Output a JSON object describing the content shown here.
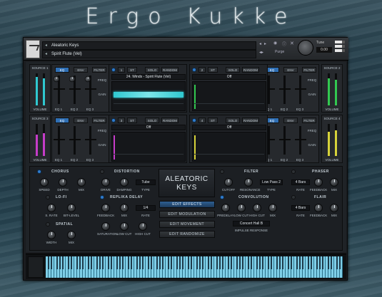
{
  "brand_title": "Ergo Kukke",
  "header": {
    "instrument_name": "Aleatoric Keys",
    "preset_name": "Spirit Flute (Vel)",
    "purge": "Purge",
    "tune_label": "Tune",
    "tune_value": "0.00"
  },
  "sources": [
    {
      "label": "SOURCE 1",
      "volume": "VOLUME",
      "color": "#2fc8d0"
    },
    {
      "label": "SOURCE 3",
      "volume": "VOLUME",
      "color": "#c53cc8"
    },
    {
      "label": "SOURCE 2",
      "volume": "VOLUME",
      "color": "#32c850"
    },
    {
      "label": "SOURCE 4",
      "volume": "VOLUME",
      "color": "#d6d23a"
    }
  ],
  "eq_tabs": [
    "EQ",
    "ENV",
    "FILTER"
  ],
  "eq_labels": {
    "freq": "FREQ",
    "gain": "GAIN",
    "eq1": "EQ 1",
    "eq2": "EQ 2",
    "eq3": "EQ 3"
  },
  "seq_buttons": {
    "st": "ST",
    "solo": "SOLO",
    "random": "RANDOM"
  },
  "sequencers": [
    {
      "num": "1",
      "name": "24. Winds - Spirit Flute (Vel)"
    },
    {
      "num": "2",
      "name": "Off"
    },
    {
      "num": "3",
      "name": "Off"
    },
    {
      "num": "4",
      "name": "Off"
    }
  ],
  "center": {
    "logo_line1": "ALEATORIC",
    "logo_line2": "KEYS",
    "buttons": [
      "EDIT EFFECTS",
      "EDIT MODULATION",
      "EDIT MOVEMENT",
      "EDIT RANDOMIZE"
    ]
  },
  "effects": {
    "chorus": {
      "title": "CHORUS",
      "knobs": [
        "SPEED",
        "DEPTH",
        "MIX"
      ]
    },
    "distortion": {
      "title": "DISTORTION",
      "knobs": [
        "DRIVE",
        "DAMPING"
      ],
      "type_label": "TYPE",
      "type_value": "Tube"
    },
    "lofi": {
      "title": "LO-FI",
      "knobs": [
        "S. RATE",
        "BIT-LEVEL"
      ]
    },
    "replika": {
      "title": "REPLIKA DELAY",
      "knobs": [
        "FEEDBACK",
        "MIX",
        "SATURATION",
        "LOW CUT",
        "HIGH CUT"
      ],
      "rate_label": "RATE",
      "rate_value": "1/4"
    },
    "spatial": {
      "title": "SPATIAL",
      "knobs": [
        "WIDTH",
        "MIX"
      ]
    },
    "filter": {
      "title": "FILTER",
      "knobs": [
        "CUTOFF",
        "RESONANCE"
      ],
      "type_label": "TYPE",
      "type_value": "Low Pass 2"
    },
    "phaser": {
      "title": "PHASER",
      "rate_value": "4 Bars",
      "knobs": [
        "RATE",
        "FEEDBACK",
        "MIX"
      ]
    },
    "convolution": {
      "title": "CONVOLUTION",
      "knobs": [
        "PREDELAY",
        "LOW CUT",
        "HIGH CUT",
        "MIX"
      ],
      "ir_value": "Concert Hall B",
      "ir_label": "IMPULSE RESPONSE"
    },
    "flair": {
      "title": "FLAIR",
      "rate_value": "4 Bars",
      "knobs": [
        "RATE",
        "FEEDBACK",
        "MIX"
      ]
    }
  },
  "colors": {
    "accent": "#2f7bcc",
    "keys": "#7fcfe8"
  }
}
